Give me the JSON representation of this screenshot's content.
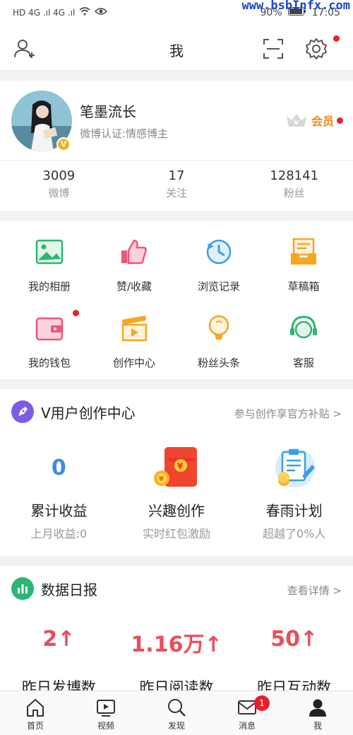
{
  "status_bar": {
    "left_indicators": "HD 4G .ıl 4G .ıl",
    "battery": "90%",
    "time": "17:05",
    "watermark": "www.bsbInfx.com"
  },
  "header": {
    "title": "我"
  },
  "profile": {
    "name": "笔墨流长",
    "verification": "微博认证:情感博主",
    "member_label": "会员",
    "badge": "V"
  },
  "stats": [
    {
      "num": "3009",
      "label": "微博"
    },
    {
      "num": "17",
      "label": "关注"
    },
    {
      "num": "128141",
      "label": "粉丝"
    }
  ],
  "grid": [
    {
      "label": "我的相册",
      "icon": "photo-album-icon",
      "color": "#2ab673"
    },
    {
      "label": "赞/收藏",
      "icon": "thumbs-up-icon",
      "color": "#f2557a"
    },
    {
      "label": "浏览记录",
      "icon": "clock-history-icon",
      "color": "#3b9ee8"
    },
    {
      "label": "草稿箱",
      "icon": "draft-box-icon",
      "color": "#f5a623"
    },
    {
      "label": "我的钱包",
      "icon": "wallet-icon",
      "color": "#f2557a"
    },
    {
      "label": "创作中心",
      "icon": "clapperboard-icon",
      "color": "#f5a623"
    },
    {
      "label": "粉丝头条",
      "icon": "lightbulb-icon",
      "color": "#f5a623"
    },
    {
      "label": "客服",
      "icon": "headset-icon",
      "color": "#2ab673"
    }
  ],
  "creator": {
    "title": "V用户创作中心",
    "link": "参与创作享官方补贴 >",
    "items": [
      {
        "value": "0",
        "title": "累计收益",
        "sub": "上月收益:0"
      },
      {
        "title": "兴趣创作",
        "sub": "实时红包激励"
      },
      {
        "title": "春雨计划",
        "sub": "超越了0%人"
      }
    ]
  },
  "report": {
    "title": "数据日报",
    "link": "查看详情 >",
    "values": [
      "2↑",
      "1.16万↑",
      "50↑"
    ],
    "labels": [
      "昨日发博数",
      "昨日阅读数",
      "昨日互动数"
    ]
  },
  "bottom_nav": [
    {
      "label": "首页",
      "icon": "home-icon"
    },
    {
      "label": "视频",
      "icon": "video-icon"
    },
    {
      "label": "发现",
      "icon": "search-icon"
    },
    {
      "label": "消息",
      "icon": "mail-icon",
      "badge": "1"
    },
    {
      "label": "我",
      "icon": "user-icon"
    }
  ],
  "colors": {
    "accent_red": "#e8202a",
    "member_orange": "#f08a1c",
    "data_red": "#e94e5b",
    "blue": "#3d8be3"
  }
}
